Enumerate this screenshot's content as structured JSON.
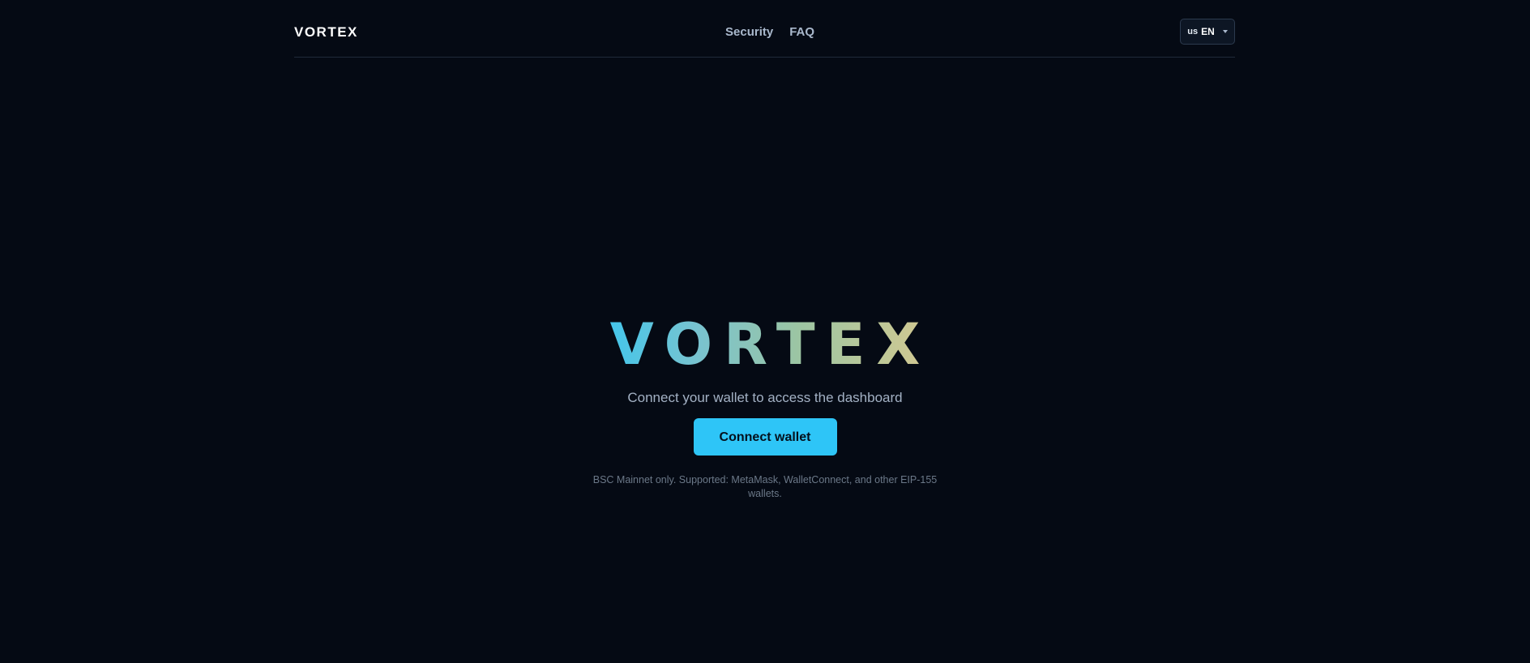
{
  "header": {
    "brand": "VORTEX",
    "nav": [
      {
        "label": "Security"
      },
      {
        "label": "FAQ"
      }
    ],
    "language": {
      "flag": "us",
      "code": "EN"
    }
  },
  "hero": {
    "title": "VORTEX",
    "subtitle": "Connect your wallet to access the dashboard",
    "cta_label": "Connect wallet",
    "note": "BSC Mainnet only. Supported: MetaMask, WalletConnect, and other EIP-155 wallets."
  },
  "colors": {
    "background": "#050a14",
    "accent": "#2ec5f7",
    "gradient_start": "#3ec6ee",
    "gradient_end": "#d4c991"
  }
}
